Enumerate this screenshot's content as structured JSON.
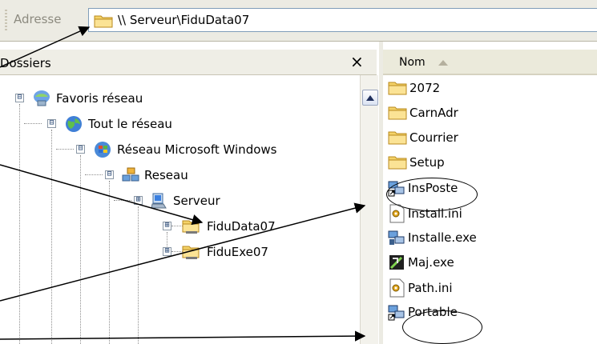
{
  "address_bar": {
    "label": "Adresse",
    "path": "\\\\ Serveur\\FiduData07"
  },
  "folders_pane": {
    "title": "Dossiers",
    "close_glyph": "×",
    "tree": [
      {
        "label": "Favoris réseau",
        "icon": "network-places-icon",
        "expander": "⊟"
      },
      {
        "label": "Tout le réseau",
        "icon": "globe-icon",
        "expander": "⊟"
      },
      {
        "label": "Réseau Microsoft Windows",
        "icon": "windows-network-icon",
        "expander": "⊟"
      },
      {
        "label": "Reseau",
        "icon": "workgroup-icon",
        "expander": "⊟"
      },
      {
        "label": "Serveur",
        "icon": "computer-icon",
        "expander": "⊞"
      },
      {
        "label": "FiduData07",
        "icon": "shared-folder-icon",
        "expander": "⊞"
      },
      {
        "label": "FiduExe07",
        "icon": "shared-folder-icon",
        "expander": "⊞"
      }
    ]
  },
  "file_list": {
    "column_name": "Nom",
    "items": [
      {
        "name": "2072",
        "icon": "folder-icon"
      },
      {
        "name": "CarnAdr",
        "icon": "folder-icon"
      },
      {
        "name": "Courrier",
        "icon": "folder-icon"
      },
      {
        "name": "Setup",
        "icon": "folder-icon"
      },
      {
        "name": "InsPoste",
        "icon": "shortcut-icon"
      },
      {
        "name": "Install.ini",
        "icon": "ini-file-icon"
      },
      {
        "name": "Installe.exe",
        "icon": "exe-icon"
      },
      {
        "name": "Maj.exe",
        "icon": "update-exe-icon"
      },
      {
        "name": "Path.ini",
        "icon": "ini-file-icon"
      },
      {
        "name": "Portable",
        "icon": "shortcut-icon"
      }
    ]
  },
  "colors": {
    "folder": "#f4d268",
    "selection_border": "#7f9db9",
    "header_bg": "#ebeadb"
  }
}
